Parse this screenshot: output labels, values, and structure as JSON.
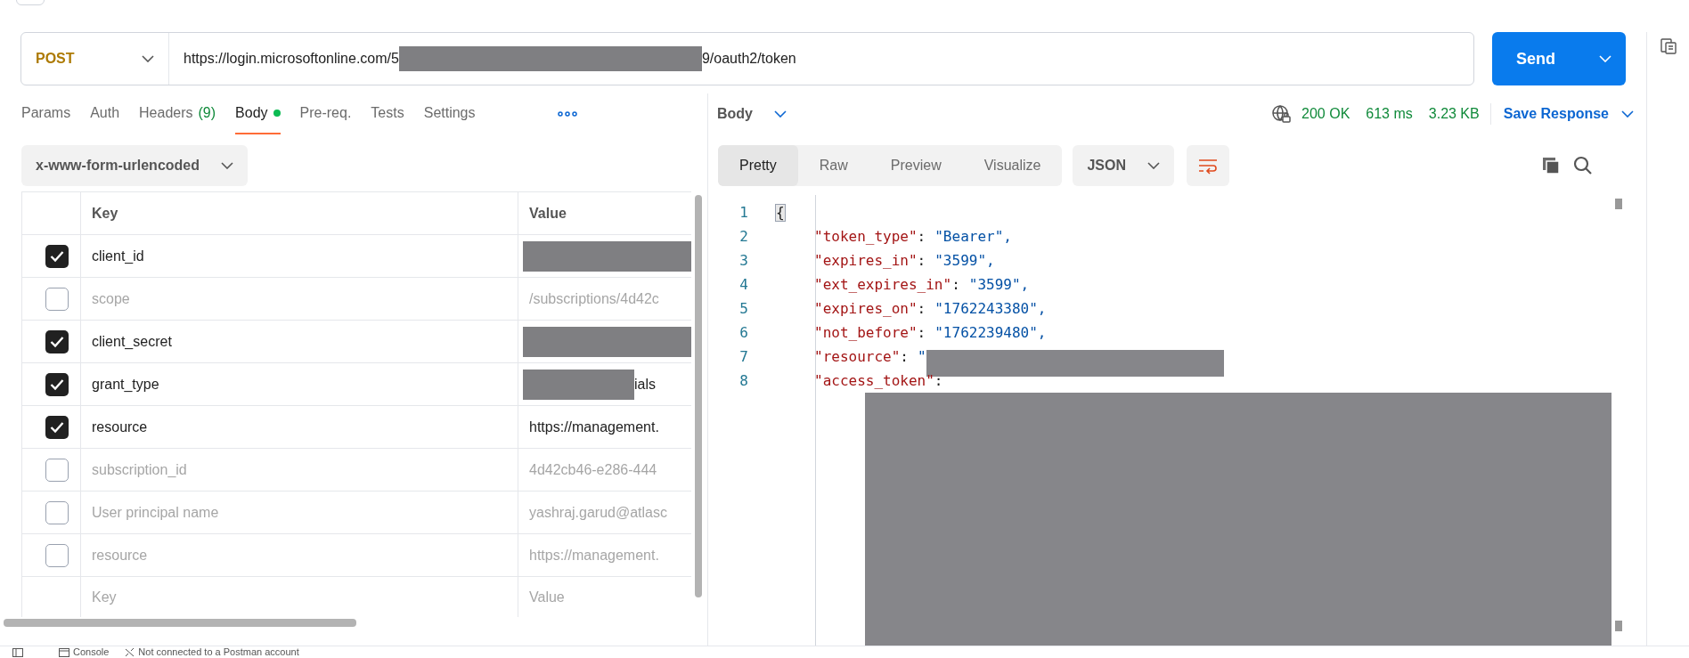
{
  "request": {
    "method": "POST",
    "url_start": "https://login.microsoftonline.com/5",
    "url_end": "9/oauth2/token",
    "send": "Send"
  },
  "request_tabs": [
    {
      "label": "Params",
      "selected": false
    },
    {
      "label": "Auth",
      "selected": false
    },
    {
      "label": "Headers",
      "count": "(9)",
      "selected": false
    },
    {
      "label": "Body",
      "dot": true,
      "selected": true
    },
    {
      "label": "Pre-req.",
      "selected": false
    },
    {
      "label": "Tests",
      "selected": false
    },
    {
      "label": "Settings",
      "selected": false
    }
  ],
  "body_type": "x-www-form-urlencoded",
  "table": {
    "columns": [
      "Key",
      "Value"
    ],
    "rows": [
      {
        "key": "client_id",
        "checked": true,
        "redacted": true
      },
      {
        "key": "scope",
        "value": "/subscriptions/4d42c",
        "checked": false
      },
      {
        "key": "client_secret",
        "checked": true,
        "redacted": true
      },
      {
        "key": "grant_type",
        "value": "ials",
        "checked": true,
        "redacted": true
      },
      {
        "key": "resource",
        "value": "https://management.",
        "checked": true
      },
      {
        "key": "subscription_id",
        "value": "4d42cb46-e286-444",
        "checked": false
      },
      {
        "key": "User principal name",
        "value": "yashraj.garud@atlasc",
        "checked": false
      },
      {
        "key": "resource",
        "value": "https://management.",
        "checked": false
      }
    ],
    "new_row": {
      "key_placeholder": "Key",
      "value_placeholder": "Value"
    }
  },
  "response": {
    "view": "Body",
    "status": "200 OK",
    "time": "613 ms",
    "size": "3.23 KB",
    "save": "Save Response",
    "modes": [
      {
        "label": "Pretty",
        "selected": true
      },
      {
        "label": "Raw",
        "selected": false
      },
      {
        "label": "Preview",
        "selected": false
      },
      {
        "label": "Visualize",
        "selected": false
      }
    ],
    "format": "JSON",
    "lines": [
      {
        "number": "1",
        "kind": "brace",
        "text": "{"
      },
      {
        "number": "2",
        "kind": "pair",
        "key": "\"token_type\"",
        "separator": ":",
        "value": "\"Bearer\","
      },
      {
        "number": "3",
        "kind": "pair",
        "key": "\"expires_in\"",
        "separator": ":",
        "value": "\"3599\","
      },
      {
        "number": "4",
        "kind": "pair",
        "key": "\"ext_expires_in\"",
        "separator": ":",
        "value": "\"3599\","
      },
      {
        "number": "5",
        "kind": "pair",
        "key": "\"expires_on\"",
        "separator": ":",
        "value": "\"1762243380\","
      },
      {
        "number": "6",
        "kind": "pair",
        "key": "\"not_before\"",
        "separator": ":",
        "value": "\"1762239480\","
      },
      {
        "number": "7",
        "kind": "redacted_pair",
        "key": "\"resource\"",
        "separator": ":",
        "value": "\""
      },
      {
        "number": "8",
        "kind": "key_only",
        "key": "\"access_token\"",
        "separator": ":"
      }
    ]
  },
  "status_bar": {
    "console": "Console",
    "connection": "Not connected to a Postman account"
  }
}
